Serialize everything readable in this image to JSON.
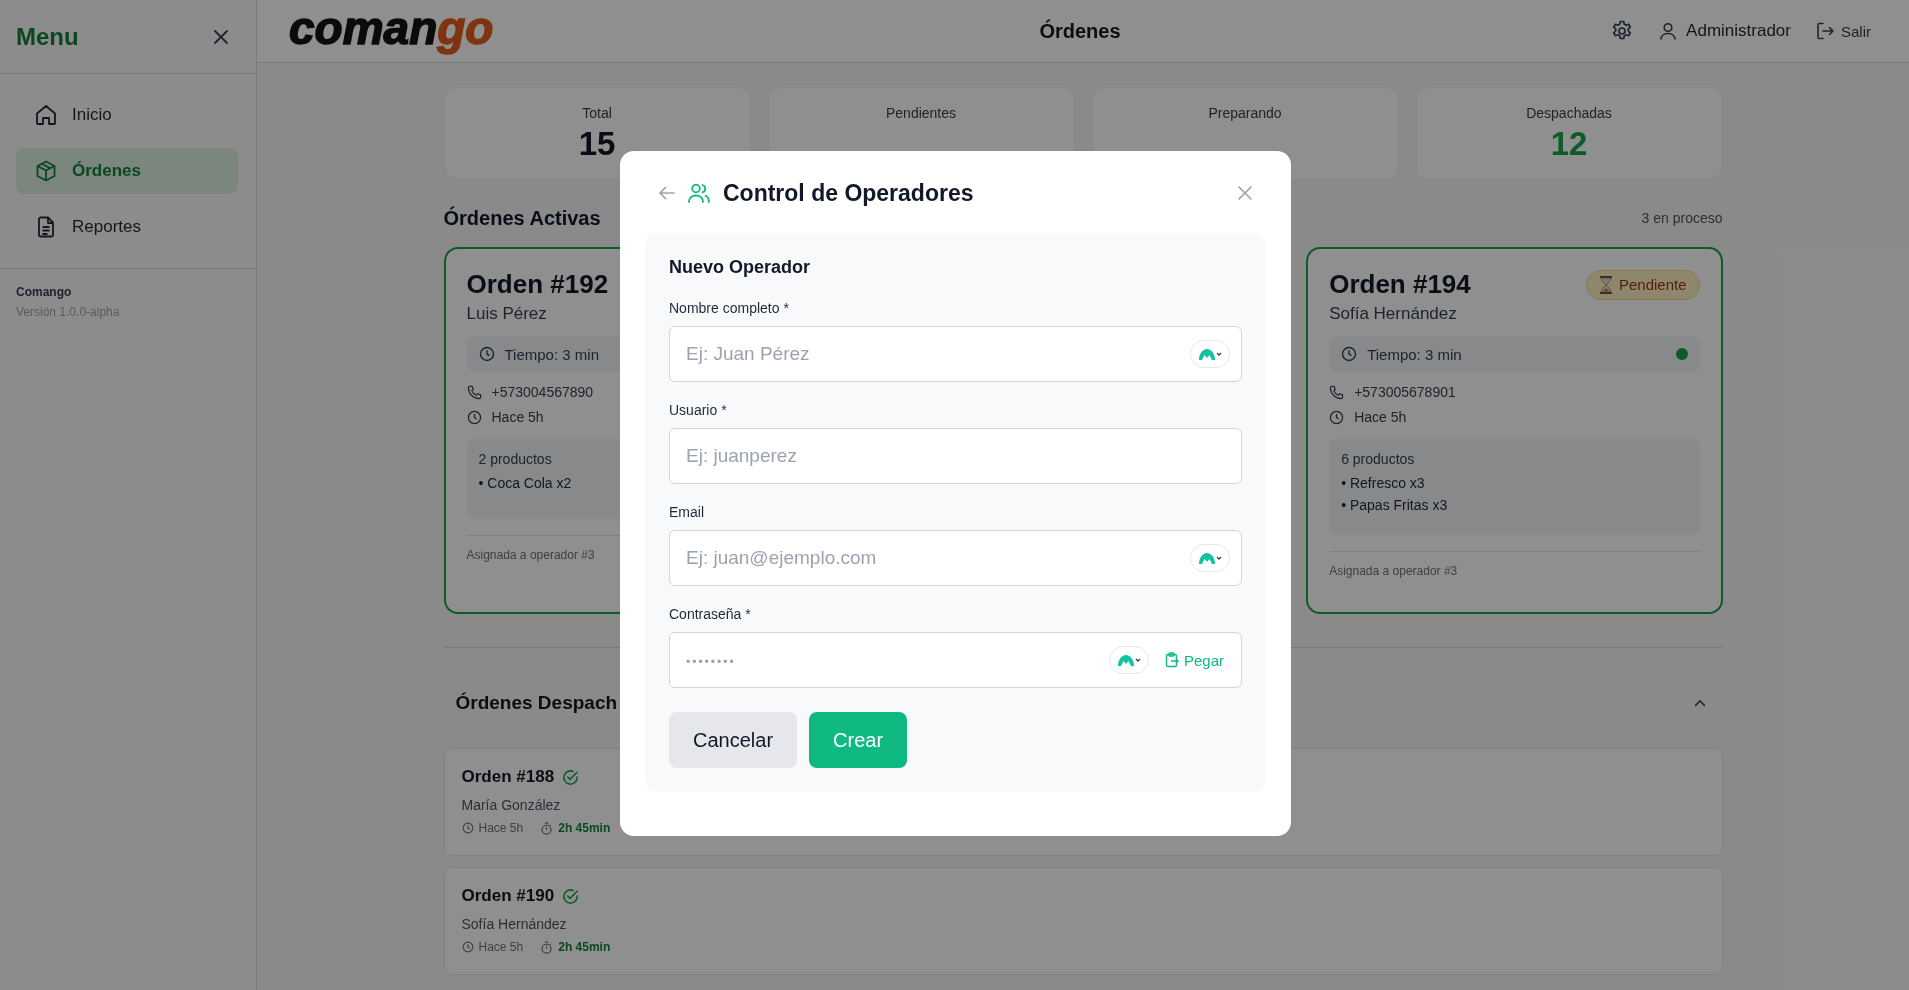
{
  "sidebar": {
    "title": "Menu",
    "items": [
      {
        "label": "Inicio",
        "selected": false
      },
      {
        "label": "Órdenes",
        "selected": true
      },
      {
        "label": "Reportes",
        "selected": false
      }
    ],
    "footer": {
      "app": "Comango",
      "version": "Versión 1.0.0-alpha"
    }
  },
  "header": {
    "logo": {
      "main": "coman",
      "accent": "go"
    },
    "title": "Órdenes",
    "user": "Administrador",
    "logout": "Salir"
  },
  "stats": [
    {
      "label": "Total",
      "value": "15"
    },
    {
      "label": "Pendientes"
    },
    {
      "label": "Preparando"
    },
    {
      "label": "Despachadas",
      "value": "12"
    }
  ],
  "active": {
    "title": "Órdenes Activas",
    "count": "3 en proceso",
    "orders": [
      {
        "title": "Orden #192",
        "customer": "Luis Pérez",
        "time": "Tiempo: 3 min",
        "phone": "+573004567890",
        "ago": "Hace 5h",
        "products": "2 productos",
        "items": [
          "• Coca Cola x2"
        ],
        "assigned": "Asignada a operador #3"
      },
      {
        "title": "Orden #194",
        "status": "Pendiente",
        "customer": "Sofía Hernández",
        "time": "Tiempo: 3 min",
        "indicator": true,
        "phone": "+573005678901",
        "ago": "Hace 5h",
        "products": "6 productos",
        "items": [
          "• Refresco x3",
          "• Papas Fritas x3"
        ],
        "assigned": "Asignada a operador #3"
      }
    ]
  },
  "dispatched": {
    "title": "Órdenes Despach",
    "expanded": true,
    "orders": [
      {
        "title": "Orden #188",
        "customer": "María González",
        "ago": "Hace 5h",
        "duration": "2h 45min"
      },
      {
        "title": "Orden #190",
        "customer": "Sofía Hernández",
        "ago": "Hace 5h",
        "duration": "2h 45min"
      }
    ]
  },
  "modal": {
    "title": "Control de Operadores",
    "form": {
      "title": "Nuevo Operador",
      "fields": [
        {
          "kind": "text",
          "label": "Nombre completo *",
          "placeholder": "Ej: Juan Pérez",
          "autofill": true
        },
        {
          "kind": "text",
          "label": "Usuario *",
          "placeholder": "Ej: juanperez",
          "autofill": false
        },
        {
          "kind": "email",
          "label": "Email",
          "placeholder": "Ej: juan@ejemplo.com",
          "autofill": true
        },
        {
          "kind": "password",
          "label": "Contraseña *",
          "placeholder": "••••••••",
          "autofill": true,
          "paste": "Pegar"
        }
      ],
      "buttons": [
        {
          "kind": "secondary",
          "label": "Cancelar"
        },
        {
          "kind": "primary",
          "label": "Crear"
        }
      ]
    }
  }
}
